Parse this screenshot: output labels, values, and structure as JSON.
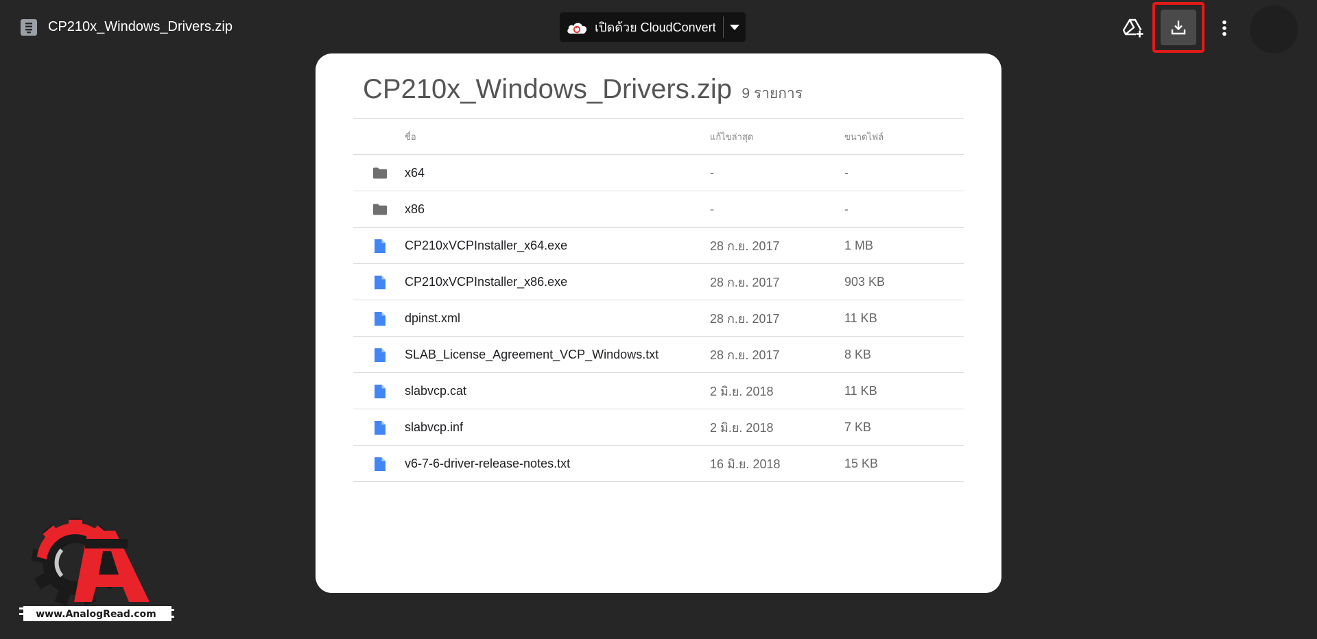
{
  "topbar": {
    "file_title": "CP210x_Windows_Drivers.zip",
    "open_with_label": "เปิดด้วย CloudConvert",
    "icons": {
      "file_type": "archive-file-icon",
      "add_to_drive": "add-to-drive-icon",
      "download": "download-icon",
      "more": "more-vert-icon",
      "open_with_dropdown": "chevron-down-icon"
    },
    "highlight_color": "#e11a1a"
  },
  "card": {
    "title": "CP210x_Windows_Drivers.zip",
    "item_count": "9 รายการ",
    "columns": {
      "name": "ชื่อ",
      "modified": "แก้ไขล่าสุด",
      "size": "ขนาดไฟล์"
    },
    "rows": [
      {
        "type": "folder",
        "name": "x64",
        "modified": "-",
        "size": "-"
      },
      {
        "type": "folder",
        "name": "x86",
        "modified": "-",
        "size": "-"
      },
      {
        "type": "file",
        "name": "CP210xVCPInstaller_x64.exe",
        "modified": "28 ก.ย. 2017",
        "size": "1 MB"
      },
      {
        "type": "file",
        "name": "CP210xVCPInstaller_x86.exe",
        "modified": "28 ก.ย. 2017",
        "size": "903 KB"
      },
      {
        "type": "file",
        "name": "dpinst.xml",
        "modified": "28 ก.ย. 2017",
        "size": "11 KB"
      },
      {
        "type": "file",
        "name": "SLAB_License_Agreement_VCP_Windows.txt",
        "modified": "28 ก.ย. 2017",
        "size": "8 KB"
      },
      {
        "type": "file",
        "name": "slabvcp.cat",
        "modified": "2 มิ.ย. 2018",
        "size": "11 KB"
      },
      {
        "type": "file",
        "name": "slabvcp.inf",
        "modified": "2 มิ.ย. 2018",
        "size": "7 KB"
      },
      {
        "type": "file",
        "name": "v6-7-6-driver-release-notes.txt",
        "modified": "16 มิ.ย. 2018",
        "size": "15 KB"
      }
    ]
  },
  "watermark": {
    "text": "www.AnalogRead.com"
  },
  "colors": {
    "background": "#262626",
    "card": "#ffffff",
    "folder_icon": "#6f6f6f",
    "file_icon": "#4285f4",
    "logo_red": "#e8232a"
  }
}
